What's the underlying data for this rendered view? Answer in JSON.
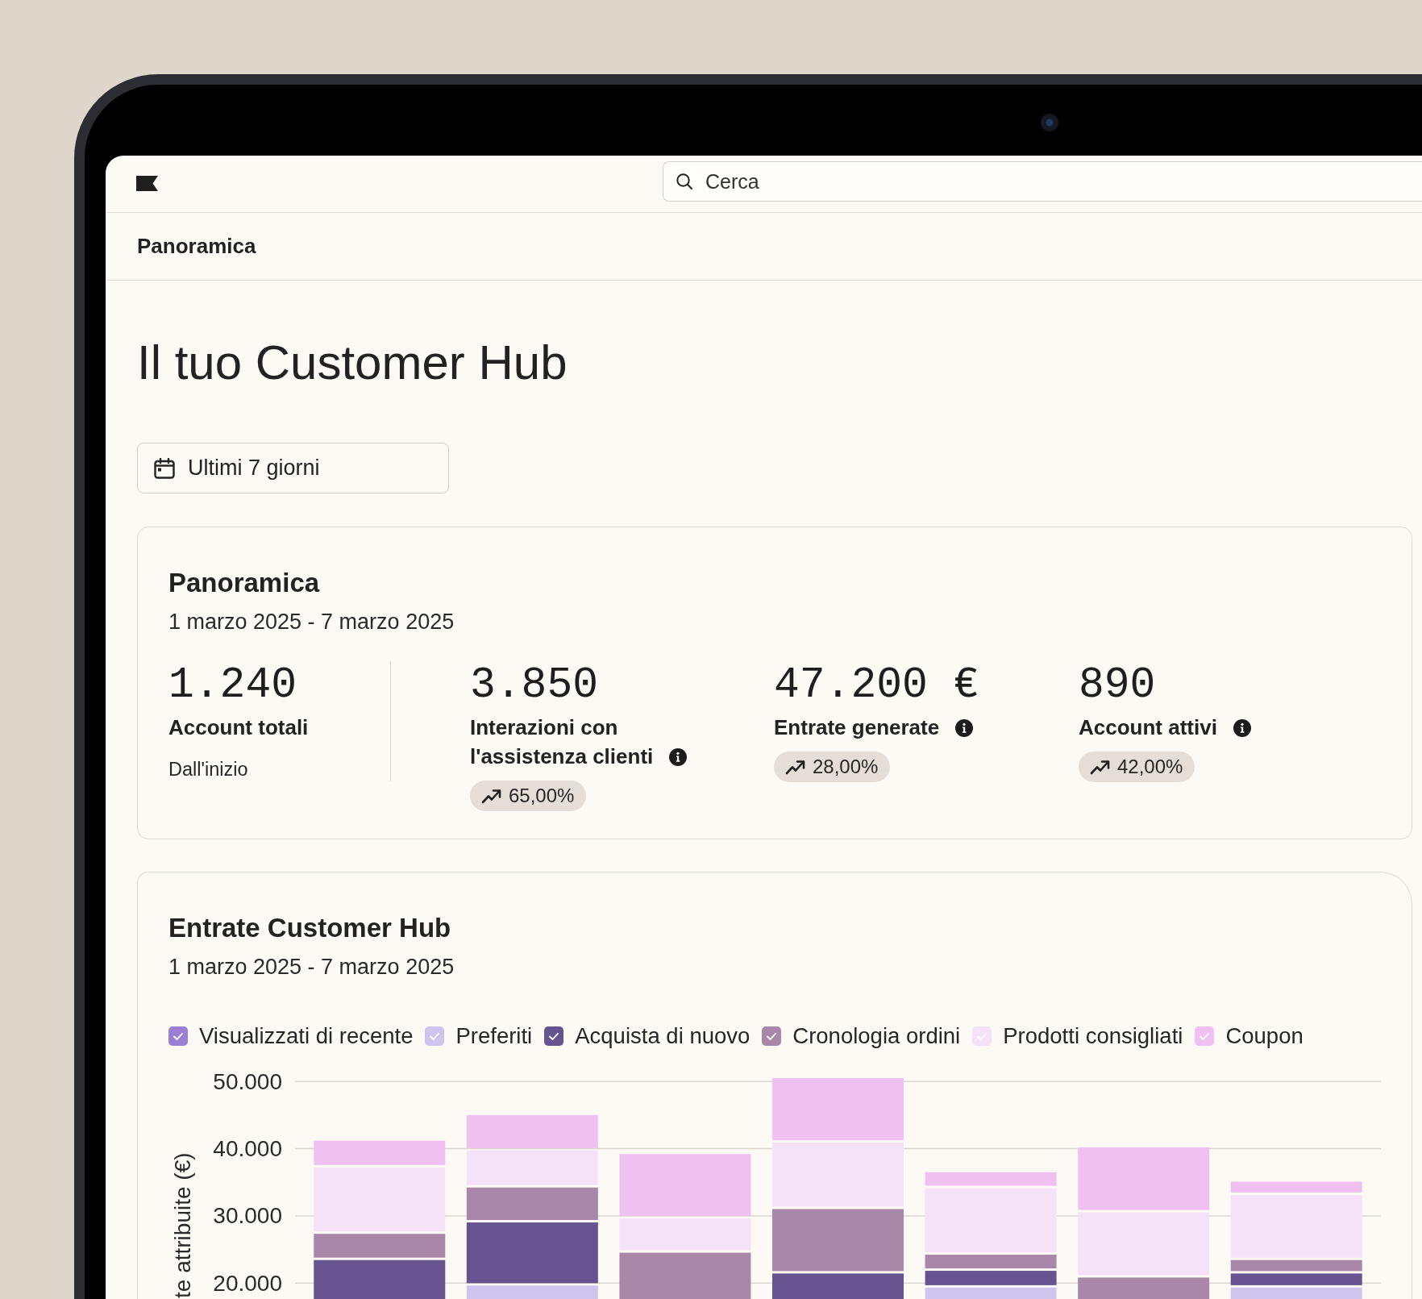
{
  "topbar": {
    "search": {
      "placeholder": "Cerca"
    }
  },
  "page_header": {
    "title": "Panoramica"
  },
  "heading": "Il tuo Customer Hub",
  "date_filter": {
    "label": "Ultimi 7 giorni"
  },
  "overview": {
    "title": "Panoramica",
    "date_range": "1 marzo 2025 - 7 marzo 2025",
    "stats": [
      {
        "value": "1.240",
        "label": "Account totali",
        "info": false,
        "note": "Dall'inizio"
      },
      {
        "value": "3.850",
        "label": "Interazioni con l'assistenza clienti",
        "info": true,
        "trend": "65,00%"
      },
      {
        "value": "47.200 €",
        "label": "Entrate generate",
        "info": true,
        "trend": "28,00%"
      },
      {
        "value": "890",
        "label": "Account attivi",
        "info": true,
        "trend": "42,00%"
      }
    ]
  },
  "revenue": {
    "title": "Entrate Customer Hub",
    "date_range": "1 marzo 2025 - 7 marzo 2025",
    "legend": [
      {
        "label": "Visualizzati di recente",
        "color": "#9a7fd5",
        "checked": true
      },
      {
        "label": "Preferiti",
        "color": "#cfc4ee",
        "checked": true
      },
      {
        "label": "Acquista di nuovo",
        "color": "#655490",
        "checked": true
      },
      {
        "label": "Cronologia ordini",
        "color": "#a987a8",
        "checked": true
      },
      {
        "label": "Prodotti consigliati",
        "color": "#f6e2f8",
        "checked": true
      },
      {
        "label": "Coupon",
        "color": "#efc0f0",
        "checked": true
      }
    ],
    "y_axis": {
      "title": "te attribuite (€)",
      "ticks": [
        "50.000",
        "40.000",
        "30.000",
        "20.000"
      ]
    }
  }
}
